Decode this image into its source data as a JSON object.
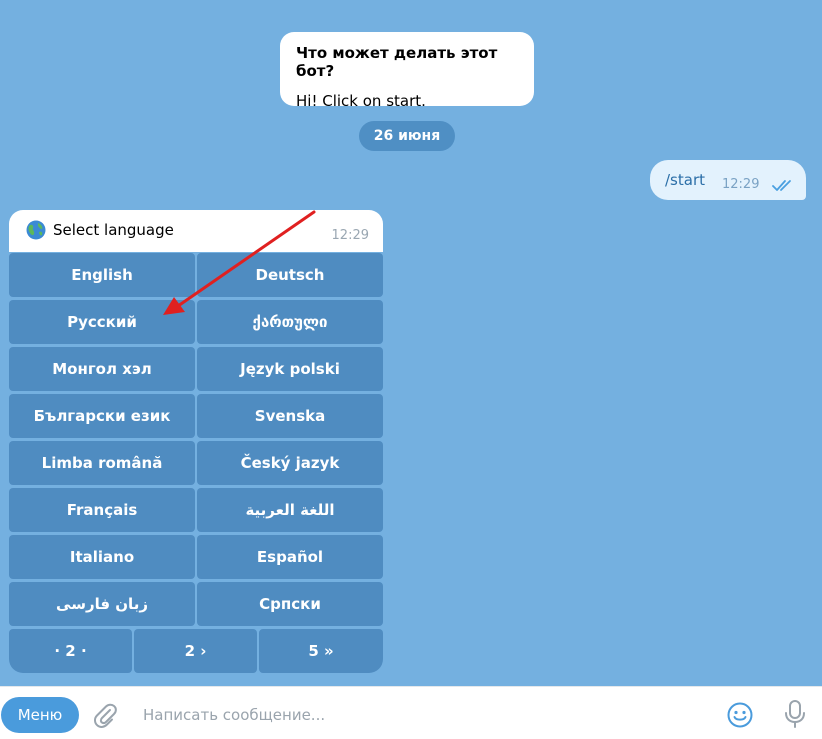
{
  "bot_description": {
    "title": "Что может делать этот бот?",
    "text": "Hi! Click on start."
  },
  "date_separator": "26 июня",
  "outgoing_message": {
    "text": "/start",
    "time": "12:29",
    "status_icon": "double-check-icon"
  },
  "incoming_message": {
    "icon": "globe-icon",
    "text": "Select language",
    "time": "12:29"
  },
  "keyboard": {
    "rows": [
      [
        "English",
        "Deutsch"
      ],
      [
        "Русский",
        "ქართული"
      ],
      [
        "Монгол хэл",
        "Język polski"
      ],
      [
        "Български език",
        "Svenska"
      ],
      [
        "Limba română",
        "Český jazyk"
      ],
      [
        "Français",
        "اللغة العربية"
      ],
      [
        "Italiano",
        "Español"
      ],
      [
        "زبان فارسی",
        "Српски"
      ]
    ],
    "pagination": [
      "· 2 ·",
      "2 ›",
      "5 »"
    ]
  },
  "bottom_bar": {
    "menu_label": "Меню",
    "input_placeholder": "Написать сообщение...",
    "attach_icon": "paperclip-icon",
    "emoji_icon": "smile-icon",
    "mic_icon": "microphone-icon"
  },
  "colors": {
    "background": "#74b0e0",
    "keyboard_button": "#4f8cc1",
    "menu_button": "#4a9bdc",
    "annotation_arrow": "#e02020"
  }
}
